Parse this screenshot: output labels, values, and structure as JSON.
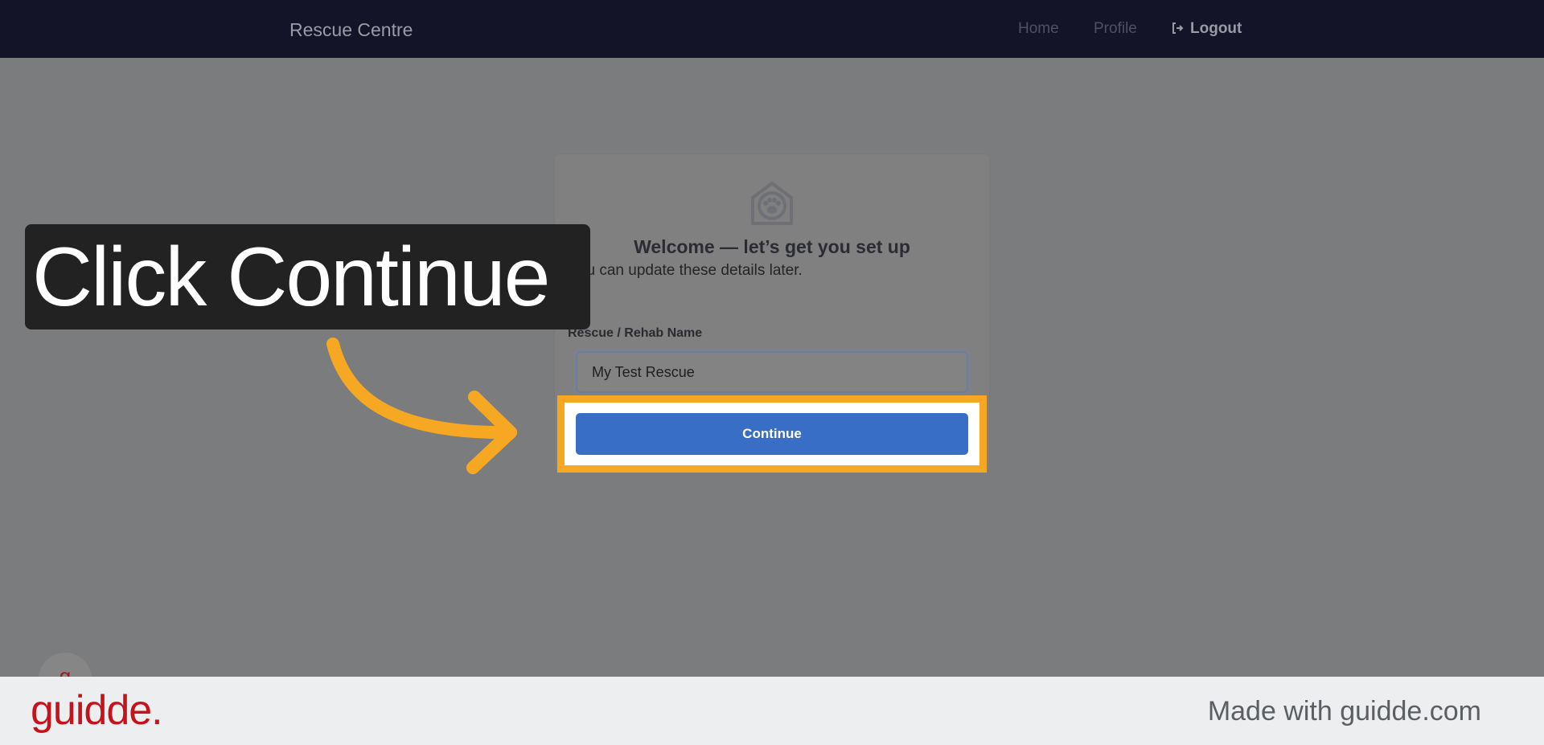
{
  "navbar": {
    "brand": "Rescue Centre",
    "links": {
      "home": "Home",
      "profile": "Profile",
      "logout": "Logout"
    }
  },
  "card": {
    "title": "Welcome — let’s get you set up",
    "subtitle": "You can update these details later.",
    "field_label": "Rescue / Rehab Name",
    "field_value": "My Test Rescue",
    "continue_label": "Continue"
  },
  "callout": {
    "text": "Click Continue"
  },
  "help_bubble": {
    "glyph": "g"
  },
  "footer": {
    "logo": "guidde.",
    "made_with": "Made with guidde.com"
  },
  "colors": {
    "nav_bg": "#131428",
    "primary_button": "#396ec6",
    "highlight": "#f7a823",
    "brand_red": "#c6131b"
  }
}
